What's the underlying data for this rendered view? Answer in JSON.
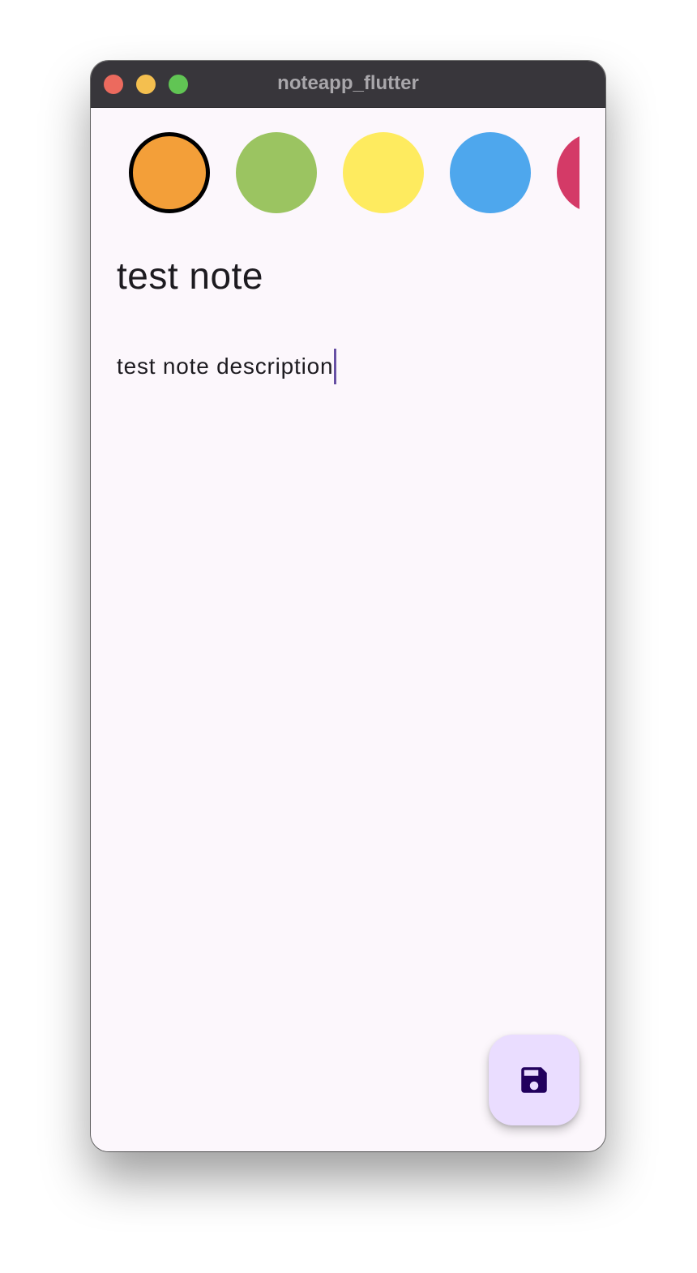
{
  "window": {
    "title": "noteapp_flutter"
  },
  "color_picker": {
    "selected_index": 0,
    "swatches": [
      {
        "name": "orange",
        "color": "#f39f39"
      },
      {
        "name": "green",
        "color": "#9bc461"
      },
      {
        "name": "yellow",
        "color": "#feeb5f"
      },
      {
        "name": "blue",
        "color": "#4ea7ed"
      },
      {
        "name": "pink",
        "color": "#d43a67"
      }
    ]
  },
  "note": {
    "title": "test note",
    "description": "test note description"
  },
  "fab": {
    "icon": "save-icon",
    "color": "#eaddff",
    "icon_color": "#21005d"
  },
  "colors": {
    "background": "#fcf7fc",
    "titlebar": "#38363b",
    "caret": "#6750a4"
  }
}
